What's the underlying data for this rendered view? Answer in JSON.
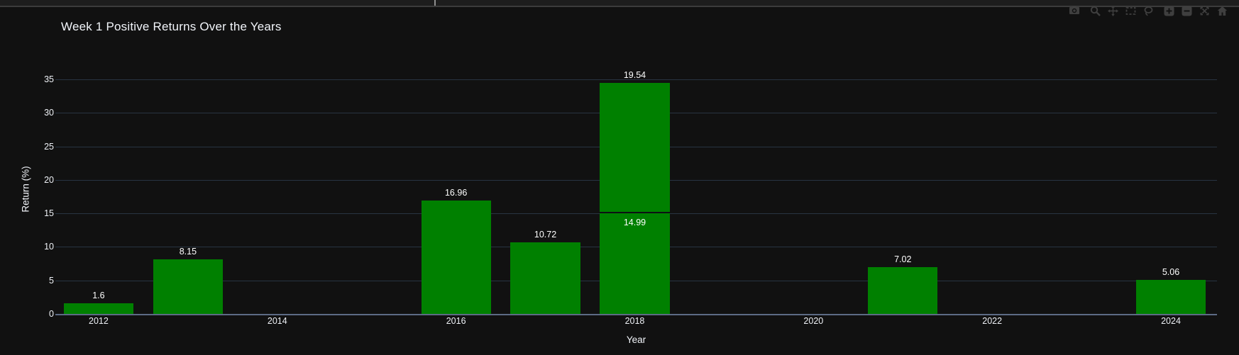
{
  "window": {
    "top_strip": {
      "divider_x": 613
    }
  },
  "toolbar": {
    "buttons": [
      {
        "name": "camera"
      },
      {
        "name": "zoom"
      },
      {
        "name": "pan"
      },
      {
        "name": "box-select"
      },
      {
        "name": "lasso"
      },
      {
        "name": "zoom-in"
      },
      {
        "name": "zoom-out"
      },
      {
        "name": "autoscale"
      },
      {
        "name": "reset-axes"
      }
    ]
  },
  "chart_data": {
    "type": "bar",
    "stacked": true,
    "title": "Week 1 Positive Returns Over the Years",
    "xlabel": "Year",
    "ylabel": "Return (%)",
    "grid": true,
    "legend": "none",
    "x_tick_labels": [
      "2012",
      "2014",
      "2016",
      "2018",
      "2020",
      "2022",
      "2024"
    ],
    "x_tick_years": [
      2012,
      2014,
      2016,
      2018,
      2020,
      2022,
      2024
    ],
    "x_range": [
      2011.516,
      2024.516
    ],
    "y_ticks": [
      0,
      5,
      10,
      15,
      20,
      25,
      30,
      35
    ],
    "ylim": [
      0,
      36.6
    ],
    "bar_width_years": 0.78,
    "bars": [
      {
        "year": 2012,
        "segments": [
          {
            "value": 1.6,
            "label": "1.6"
          }
        ]
      },
      {
        "year": 2013,
        "segments": [
          {
            "value": 8.15,
            "label": "8.15"
          }
        ]
      },
      {
        "year": 2016,
        "segments": [
          {
            "value": 16.96,
            "label": "16.96"
          }
        ]
      },
      {
        "year": 2017,
        "segments": [
          {
            "value": 10.72,
            "label": "10.72"
          }
        ]
      },
      {
        "year": 2018,
        "segments": [
          {
            "value": 14.99,
            "label": "14.99"
          },
          {
            "value": 19.54,
            "label": "19.54"
          }
        ]
      },
      {
        "year": 2021,
        "segments": [
          {
            "value": 7.02,
            "label": "7.02"
          }
        ]
      },
      {
        "year": 2024,
        "segments": [
          {
            "value": 5.06,
            "label": "5.06"
          }
        ]
      }
    ]
  },
  "colors": {
    "page_bg": "#111111",
    "bar_green": "#008000",
    "grid": "#283442",
    "zeroline": "#5d6b85",
    "text": "#f2f5fa",
    "modebar_icon": "#3f3f3f",
    "top_strip_bg": "#1d1d1d",
    "top_strip_border": "#3b3b3b"
  }
}
